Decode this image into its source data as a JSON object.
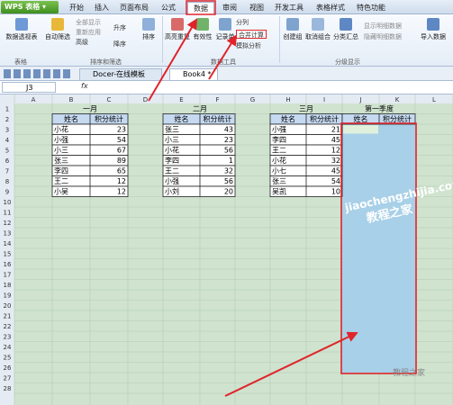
{
  "app": {
    "name": "WPS 表格"
  },
  "tabs": [
    "开始",
    "插入",
    "页面布局",
    "公式",
    "数据",
    "审阅",
    "视图",
    "开发工具",
    "表格样式",
    "特色功能"
  ],
  "active_tab": "数据",
  "ribbon": {
    "pivot": "数据透视表",
    "autofilter": "自动筛选",
    "show_all": "全部显示",
    "reapply": "重新应用",
    "advanced": "高级",
    "asc": "升序",
    "desc": "降序",
    "sort": "排序",
    "highlight_dup": "高亮重复",
    "validation": "有效性",
    "record": "记录单",
    "split": "分列",
    "consolidate": "合并计算",
    "whatif": "模拟分析",
    "create_group": "创建组",
    "ungroup": "取消组合",
    "subtotal": "分类汇总",
    "show_detail": "显示明细数据",
    "hide_detail": "隐藏明细数据",
    "import": "导入数据",
    "grp_table": "表格",
    "grp_sortfilter": "排序和筛选",
    "grp_tools": "数据工具",
    "grp_outline": "分级显示"
  },
  "doc_tabs": [
    "Docer-在线模板",
    "Book4 *"
  ],
  "formula_bar": {
    "cell_ref": "J3",
    "fx": "fx"
  },
  "columns": [
    "A",
    "B",
    "C",
    "D",
    "E",
    "F",
    "G",
    "H",
    "I",
    "J",
    "K",
    "L"
  ],
  "rows": [
    "1",
    "2",
    "3",
    "4",
    "5",
    "6",
    "7",
    "8",
    "9",
    "10",
    "11",
    "12",
    "13",
    "14",
    "15",
    "16",
    "17",
    "18",
    "19",
    "20",
    "21",
    "22",
    "23",
    "24",
    "25",
    "26",
    "27",
    "28"
  ],
  "tables": [
    {
      "title": "一月",
      "headers": [
        "姓名",
        "积分统计"
      ],
      "rows": [
        [
          "小花",
          "23"
        ],
        [
          "小强",
          "54"
        ],
        [
          "小三",
          "67"
        ],
        [
          "张三",
          "89"
        ],
        [
          "李四",
          "65"
        ],
        [
          "王二",
          "12"
        ],
        [
          "小吴",
          "12"
        ]
      ]
    },
    {
      "title": "二月",
      "headers": [
        "姓名",
        "积分统计"
      ],
      "rows": [
        [
          "张三",
          "43"
        ],
        [
          "小三",
          "23"
        ],
        [
          "小花",
          "56"
        ],
        [
          "李四",
          "1"
        ],
        [
          "王二",
          "32"
        ],
        [
          "小强",
          "56"
        ],
        [
          "小刘",
          "20"
        ]
      ]
    },
    {
      "title": "三月",
      "headers": [
        "姓名",
        "积分统计"
      ],
      "rows": [
        [
          "小强",
          "21"
        ],
        [
          "李四",
          "45"
        ],
        [
          "王二",
          "12"
        ],
        [
          "小花",
          "32"
        ],
        [
          "小七",
          "45"
        ],
        [
          "张三",
          "54"
        ],
        [
          "吴凯",
          "10"
        ]
      ]
    },
    {
      "title": "第一季度",
      "headers": [
        "姓名",
        "积分统计"
      ],
      "rows": []
    }
  ],
  "watermark": {
    "line1": "jiaochengzhijia.com",
    "line2": "教程之家",
    "line3": "教程之家"
  },
  "colors": {
    "header_fill": "#c5d9f1",
    "selection_fill": "#a8d0e8",
    "highlight_red": "#e0242a",
    "grid_bg": "#cfe3cf"
  }
}
